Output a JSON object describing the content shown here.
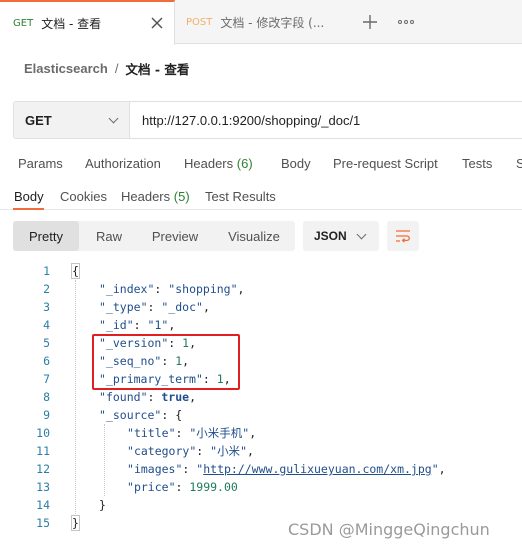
{
  "tabs": [
    {
      "method": "GET",
      "title": "文档 - 查看",
      "active": true
    },
    {
      "method": "POST",
      "title": "文档 - 修改字段 (..."
    }
  ],
  "breadcrumb": {
    "parent": "Elasticsearch",
    "separator": "/",
    "current": "文档 - 查看"
  },
  "request": {
    "method": "GET",
    "url": "http://127.0.0.1:9200/shopping/_doc/1"
  },
  "request_tabs": {
    "params": "Params",
    "authorization": "Authorization",
    "headers": "Headers",
    "headers_count": "(6)",
    "body": "Body",
    "prerequest": "Pre-request Script",
    "tests": "Tests",
    "overflow": "S"
  },
  "response_tabs": {
    "body": "Body",
    "cookies": "Cookies",
    "headers": "Headers",
    "headers_count": "(5)",
    "test_results": "Test Results"
  },
  "view_modes": {
    "pretty": "Pretty",
    "raw": "Raw",
    "preview": "Preview",
    "visualize": "Visualize",
    "active": "Pretty"
  },
  "format": "JSON",
  "code_lines": [
    {
      "n": "1",
      "open": "{"
    },
    {
      "n": "2",
      "key": "_index",
      "str": "shopping"
    },
    {
      "n": "3",
      "key": "_type",
      "str": "_doc"
    },
    {
      "n": "4",
      "key": "_id",
      "str": "1"
    },
    {
      "n": "5",
      "key": "_version",
      "num": "1"
    },
    {
      "n": "6",
      "key": "_seq_no",
      "num": "1"
    },
    {
      "n": "7",
      "key": "_primary_term",
      "num": "1"
    },
    {
      "n": "8",
      "key": "found",
      "bool": "true"
    },
    {
      "n": "9",
      "key": "_source",
      "open": "{"
    },
    {
      "n": "10",
      "key": "title",
      "str": "小米手机"
    },
    {
      "n": "11",
      "key": "category",
      "str": "小米"
    },
    {
      "n": "12",
      "key": "images",
      "url": "http://www.gulixueyuan.com/xm.jpg"
    },
    {
      "n": "13",
      "key": "price",
      "num": "1999.00"
    },
    {
      "n": "14",
      "close": "}"
    },
    {
      "n": "15",
      "close": "}"
    }
  ],
  "watermark": "CSDN @MinggeQingchun",
  "colors": {
    "accent": "#f26b3a",
    "get": "#2f8132",
    "post": "#f2b06b",
    "highlight": "#e02020"
  }
}
